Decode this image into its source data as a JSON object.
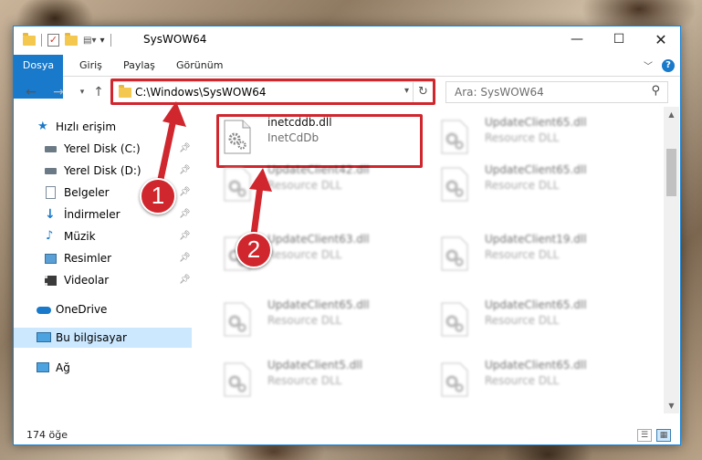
{
  "window": {
    "title": "SysWOW64"
  },
  "ribbon": {
    "tabs": [
      "Dosya",
      "Giriş",
      "Paylaş",
      "Görünüm"
    ]
  },
  "navigation": {
    "address": "C:\\Windows\\SysWOW64",
    "search_placeholder": "Ara: SysWOW64"
  },
  "sidebar": {
    "items": [
      {
        "label": "Hızlı erişim",
        "icon": "star-icon"
      },
      {
        "label": "Yerel Disk (C:)",
        "icon": "drive-icon",
        "pinned": true
      },
      {
        "label": "Yerel Disk (D:)",
        "icon": "drive-icon",
        "pinned": true
      },
      {
        "label": "Belgeler",
        "icon": "documents-icon",
        "pinned": true
      },
      {
        "label": "İndirmeler",
        "icon": "download-icon",
        "pinned": true
      },
      {
        "label": "Müzik",
        "icon": "music-icon",
        "pinned": true
      },
      {
        "label": "Resimler",
        "icon": "pictures-icon",
        "pinned": true
      },
      {
        "label": "Videolar",
        "icon": "videos-icon",
        "pinned": true
      },
      {
        "label": "OneDrive",
        "icon": "onedrive-icon"
      },
      {
        "label": "Bu bilgisayar",
        "icon": "computer-icon",
        "selected": true
      },
      {
        "label": "Ağ",
        "icon": "network-icon"
      }
    ]
  },
  "files": [
    {
      "name": "inetcddb.dll",
      "desc": "InetCdDb",
      "highlighted": true
    },
    {
      "name": "UpdateClient65.dll",
      "desc": "Resource DLL"
    },
    {
      "name": "UpdateClient42.dll",
      "desc": "Resource DLL"
    },
    {
      "name": "UpdateClient65.dll",
      "desc": "Resource DLL"
    },
    {
      "name": "UpdateClient63.dll",
      "desc": "Resource DLL"
    },
    {
      "name": "UpdateClient19.dll",
      "desc": "Resource DLL"
    },
    {
      "name": "UpdateClient65.dll",
      "desc": "Resource DLL"
    },
    {
      "name": "UpdateClient65.dll",
      "desc": "Resource DLL"
    },
    {
      "name": "UpdateClient5.dll",
      "desc": "Resource DLL"
    },
    {
      "name": "UpdateClient65.dll",
      "desc": "Resource DLL"
    }
  ],
  "status": {
    "item_count": "174 öğe"
  },
  "annotations": {
    "step1": "1",
    "step2": "2",
    "color": "#d0262d"
  },
  "colors": {
    "accent": "#1979ca",
    "selection": "#cce8ff",
    "highlight": "#d0262d"
  }
}
